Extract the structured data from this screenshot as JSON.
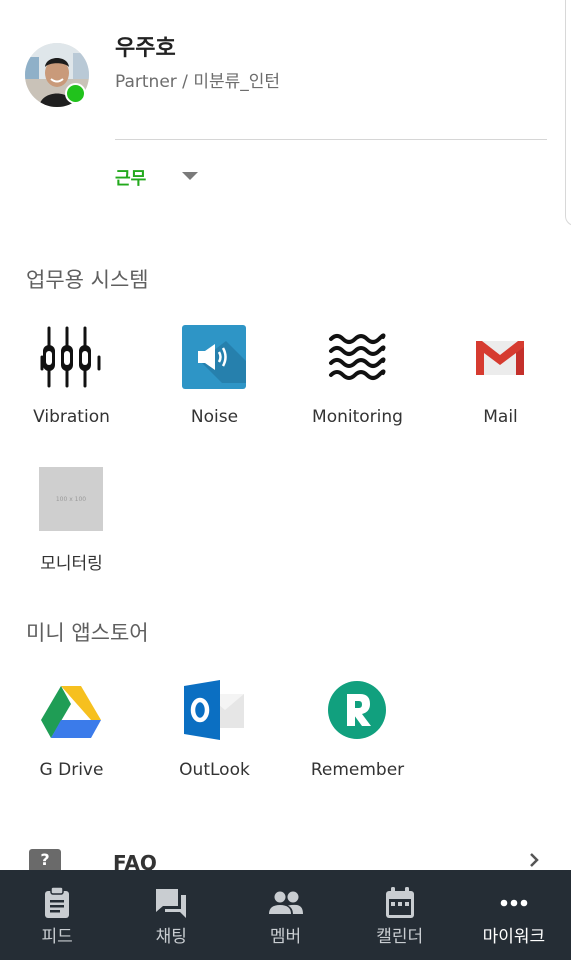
{
  "profile": {
    "name": "우주호",
    "role": "Partner / 미분류_인턴",
    "status": "근무"
  },
  "sections": {
    "work_systems": {
      "title": "업무용 시스템",
      "apps": [
        {
          "label": "Vibration",
          "icon": "vibration-icon"
        },
        {
          "label": "Noise",
          "icon": "noise-icon"
        },
        {
          "label": "Monitoring",
          "icon": "monitoring-icon"
        },
        {
          "label": "Mail",
          "icon": "mail-icon"
        },
        {
          "label": "모니터링",
          "icon": "placeholder-icon",
          "placeholder_text": "100 x 100"
        }
      ]
    },
    "mini_store": {
      "title": "미니 앱스토어",
      "apps": [
        {
          "label": "G Drive",
          "icon": "google-drive-icon"
        },
        {
          "label": "OutLook",
          "icon": "outlook-icon"
        },
        {
          "label": "Remember",
          "icon": "remember-icon"
        }
      ]
    }
  },
  "faq": {
    "label": "FAQ",
    "icon_glyph": "?"
  },
  "bottom_nav": {
    "items": [
      {
        "label": "피드",
        "icon": "feed-icon"
      },
      {
        "label": "채팅",
        "icon": "chat-icon"
      },
      {
        "label": "멤버",
        "icon": "members-icon"
      },
      {
        "label": "캘린더",
        "icon": "calendar-icon"
      },
      {
        "label": "마이워크",
        "icon": "more-icon",
        "active": true
      }
    ]
  },
  "colors": {
    "status_green": "#22a91c",
    "online_dot": "#21c21c",
    "nav_background": "#252d35",
    "noise_tile": "#2e95c6"
  }
}
